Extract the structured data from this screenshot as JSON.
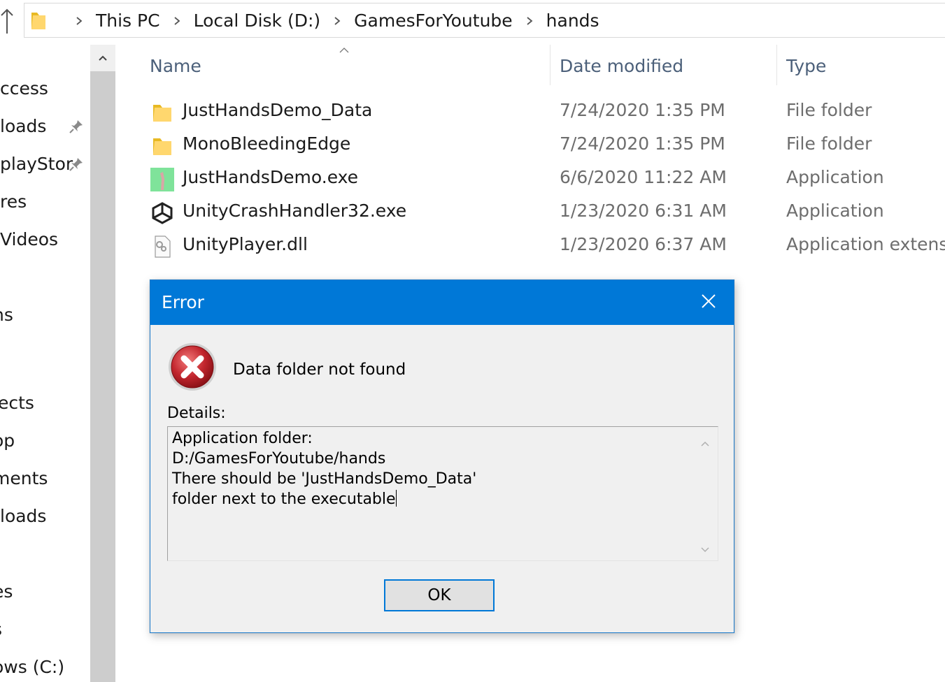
{
  "address_bar": {
    "crumbs": [
      "This PC",
      "Local Disk (D:)",
      "GamesForYoutube",
      "hands"
    ]
  },
  "nav_pane": {
    "items": [
      "ccess",
      "loads",
      "playStor",
      "res",
      "Videos",
      "ns",
      "jects",
      "op",
      "ments",
      "loads",
      "es",
      "s",
      "ows (C:)"
    ]
  },
  "file_list": {
    "columns": {
      "name": "Name",
      "date": "Date modified",
      "type": "Type"
    },
    "sort_column": "Name",
    "rows": [
      {
        "name": "JustHandsDemo_Data",
        "date": "7/24/2020 1:35 PM",
        "type": "File folder",
        "icon": "folder-icon"
      },
      {
        "name": "MonoBleedingEdge",
        "date": "7/24/2020 1:35 PM",
        "type": "File folder",
        "icon": "folder-icon"
      },
      {
        "name": "JustHandsDemo.exe",
        "date": "6/6/2020 11:22 AM",
        "type": "Application",
        "icon": "app-icon"
      },
      {
        "name": "UnityCrashHandler32.exe",
        "date": "1/23/2020 6:31 AM",
        "type": "Application",
        "icon": "unity-icon"
      },
      {
        "name": "UnityPlayer.dll",
        "date": "1/23/2020 6:37 AM",
        "type": "Application extens...",
        "icon": "dll-icon"
      }
    ]
  },
  "dialog": {
    "title": "Error",
    "message": "Data folder not found",
    "details_label": "Details:",
    "details_text": "Application folder:\nD:/GamesForYoutube/hands\nThere should be 'JustHandsDemo_Data'\nfolder next to the executable",
    "ok_label": "OK"
  },
  "colors": {
    "titlebar": "#0078d7",
    "header_text": "#4c607a",
    "folder": "#ffd76e",
    "error_red": "#c2262e"
  }
}
